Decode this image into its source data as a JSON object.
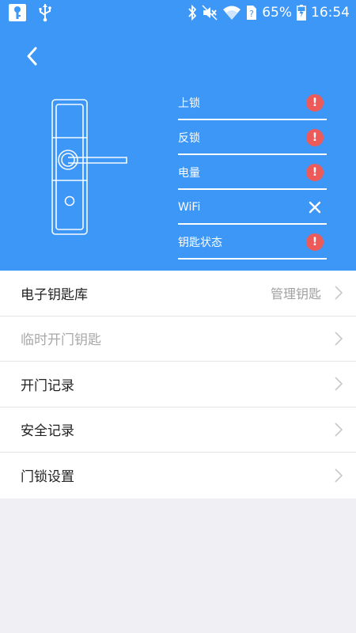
{
  "statusbar": {
    "battery": "65%",
    "time": "16:54",
    "icons": [
      "app-notification-icon",
      "usb-icon",
      "bluetooth-icon",
      "mute-icon",
      "wifi-icon",
      "sim-icon",
      "battery-icon"
    ]
  },
  "colors": {
    "header_bg": "#3d97f6",
    "alert": "#ec5a5a",
    "page_bg": "#efeff4"
  },
  "status_items": [
    {
      "label": "上锁",
      "icon": "alert-icon"
    },
    {
      "label": "反锁",
      "icon": "alert-icon"
    },
    {
      "label": "电量",
      "icon": "alert-icon"
    },
    {
      "label": "WiFi",
      "icon": "close-icon"
    },
    {
      "label": "钥匙状态",
      "icon": "alert-icon"
    }
  ],
  "alert_symbol": "!",
  "menu": [
    {
      "label": "电子钥匙库",
      "value": "管理钥匙",
      "disabled": false
    },
    {
      "label": "临时开门钥匙",
      "value": "",
      "disabled": true
    },
    {
      "label": "开门记录",
      "value": "",
      "disabled": false
    },
    {
      "label": "安全记录",
      "value": "",
      "disabled": false
    },
    {
      "label": "门锁设置",
      "value": "",
      "disabled": false
    }
  ]
}
